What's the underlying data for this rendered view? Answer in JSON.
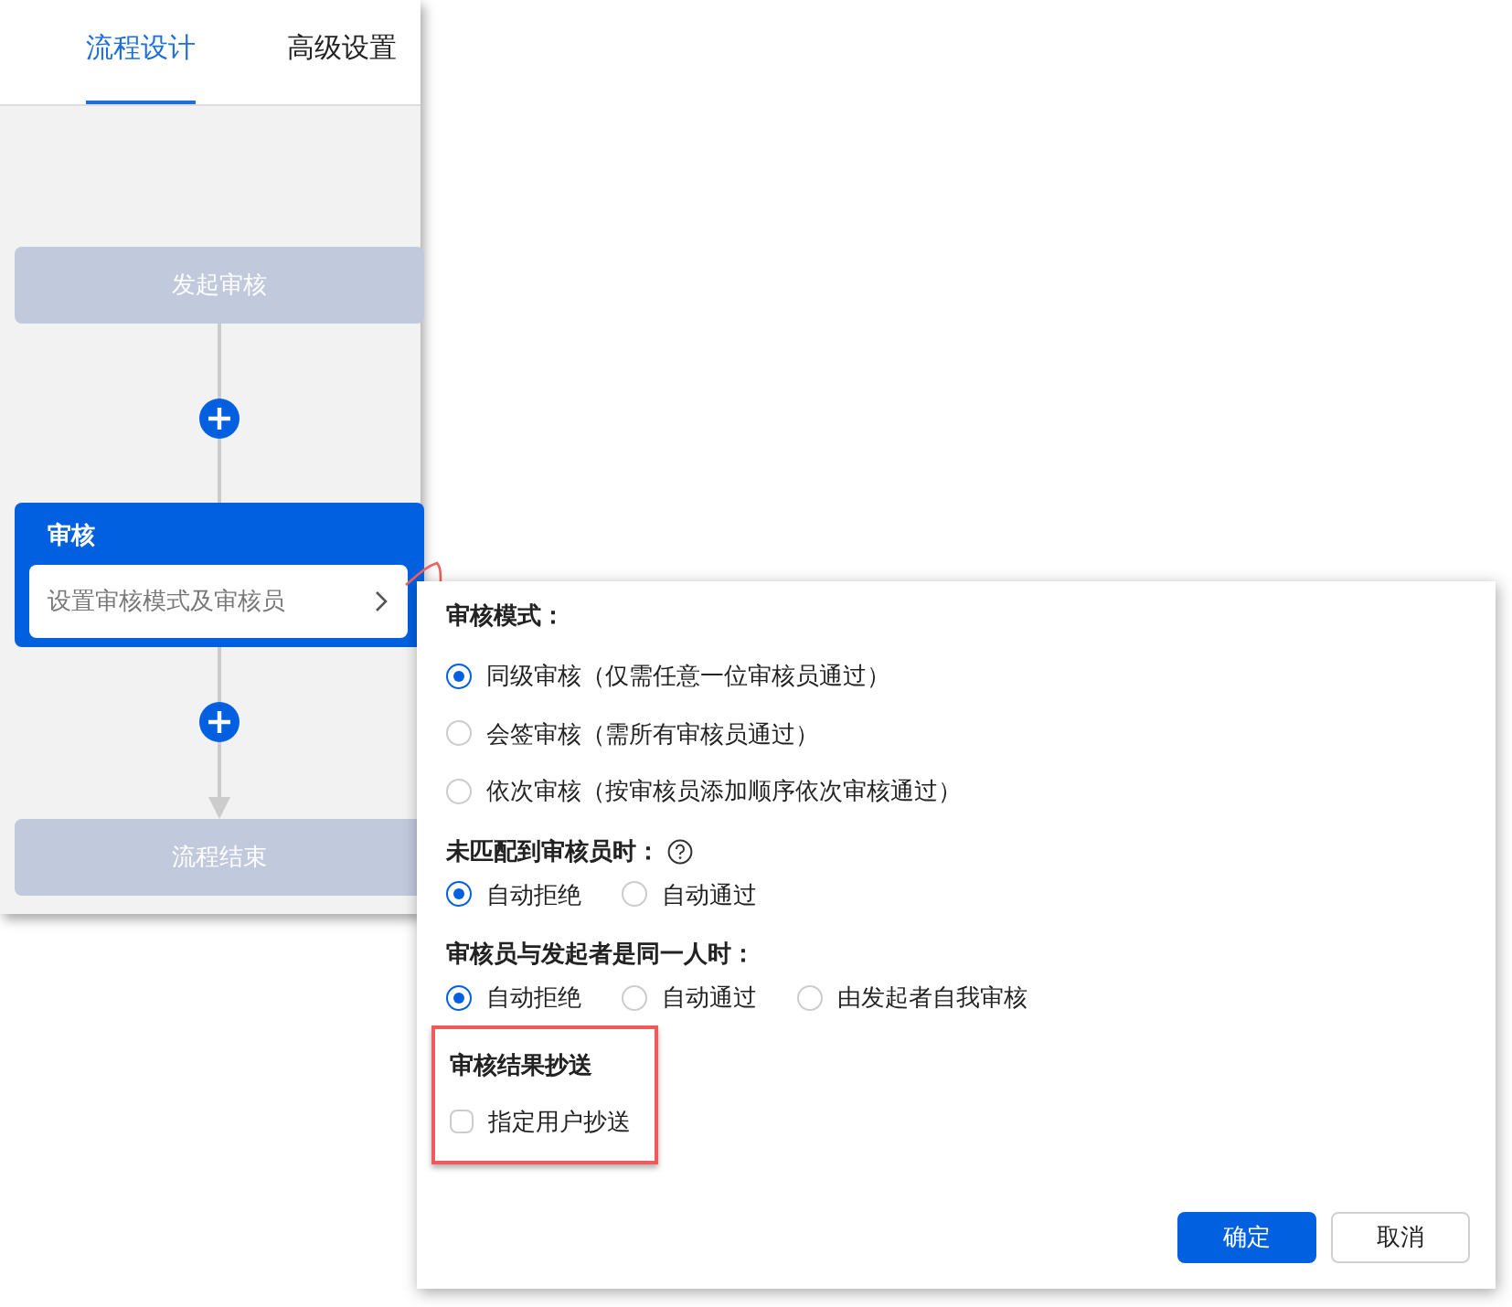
{
  "tabs": [
    {
      "label": "流程设计",
      "selected": true
    },
    {
      "label": "高级设置",
      "selected": false
    }
  ],
  "flow": {
    "start": "发起审核",
    "review": {
      "title": "审核",
      "action": "设置审核模式及审核员"
    },
    "end": "流程结束"
  },
  "settings": {
    "sections": [
      {
        "title": "审核模式：",
        "help": false,
        "kind": "column",
        "options": [
          {
            "label": "同级审核（仅需任意一位审核员通过）",
            "selected": true
          },
          {
            "label": "会签审核（需所有审核员通过）",
            "selected": false
          },
          {
            "label": "依次审核（按审核员添加顺序依次审核通过）",
            "selected": false
          }
        ]
      },
      {
        "title": "未匹配到审核员时：",
        "help": true,
        "kind": "row",
        "options": [
          {
            "label": "自动拒绝",
            "selected": true
          },
          {
            "label": "自动通过",
            "selected": false
          }
        ]
      },
      {
        "title": "审核员与发起者是同一人时：",
        "help": false,
        "kind": "row",
        "options": [
          {
            "label": "自动拒绝",
            "selected": true
          },
          {
            "label": "自动通过",
            "selected": false
          },
          {
            "label": "由发起者自我审核",
            "selected": false
          }
        ]
      }
    ],
    "cc": {
      "title": "审核结果抄送",
      "highlighted": true,
      "checkbox": {
        "label": "指定用户抄送",
        "checked": false
      }
    },
    "buttons": [
      {
        "label": "确定",
        "kind": "primary"
      },
      {
        "label": "取消",
        "kind": "secondary"
      }
    ]
  }
}
